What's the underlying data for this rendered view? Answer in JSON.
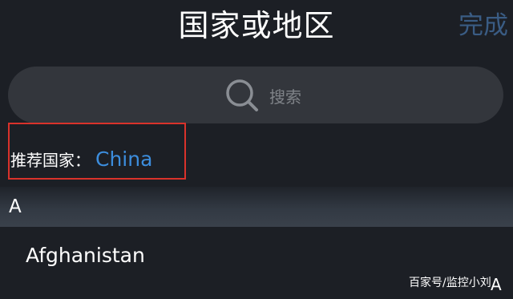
{
  "header": {
    "title": "国家或地区",
    "done_label": "完成"
  },
  "search": {
    "placeholder": "搜索"
  },
  "recommended": {
    "label": "推荐国家：",
    "country": "China"
  },
  "sections": [
    {
      "letter": "A",
      "countries": [
        "Afghanistan"
      ]
    }
  ],
  "index_bar": {
    "visible_letter": "A"
  },
  "watermark": "百家号/监控小刘",
  "colors": {
    "background": "#1c1f25",
    "accent_blue": "#3c8ddd",
    "done_text": "#3a5c84",
    "highlight_border": "#d9322b"
  }
}
